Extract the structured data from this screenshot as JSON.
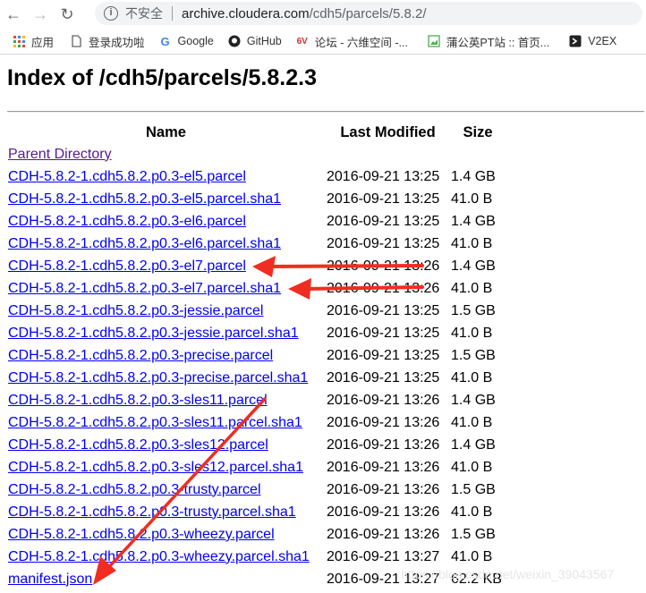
{
  "browser": {
    "security_label": "不安全",
    "url_host": "archive.cloudera.com",
    "url_path": "/cdh5/parcels/5.8.2/"
  },
  "bookmarks": [
    {
      "label": "应用",
      "icon": "apps-grid-icon"
    },
    {
      "label": "登录成功啦",
      "icon": "page-icon"
    },
    {
      "label": "Google",
      "icon": "google-icon"
    },
    {
      "label": "GitHub",
      "icon": "github-icon"
    },
    {
      "label": "论坛 - 六维空间 -...",
      "icon": "site-icon"
    },
    {
      "label": "蒲公英PT站 :: 首页...",
      "icon": "image-icon"
    },
    {
      "label": "V2EX",
      "icon": "v2ex-icon"
    }
  ],
  "page": {
    "title": "Index of /cdh5/parcels/5.8.2.3",
    "columns": {
      "name": "Name",
      "last_modified": "Last Modified",
      "size": "Size"
    },
    "parent_link": "Parent Directory",
    "files": [
      {
        "name": "CDH-5.8.2-1.cdh5.8.2.p0.3-el5.parcel",
        "modified": "2016-09-21 13:25",
        "size": "1.4 GB"
      },
      {
        "name": "CDH-5.8.2-1.cdh5.8.2.p0.3-el5.parcel.sha1",
        "modified": "2016-09-21 13:25",
        "size": "41.0 B"
      },
      {
        "name": "CDH-5.8.2-1.cdh5.8.2.p0.3-el6.parcel",
        "modified": "2016-09-21 13:25",
        "size": "1.4 GB"
      },
      {
        "name": "CDH-5.8.2-1.cdh5.8.2.p0.3-el6.parcel.sha1",
        "modified": "2016-09-21 13:25",
        "size": "41.0 B"
      },
      {
        "name": "CDH-5.8.2-1.cdh5.8.2.p0.3-el7.parcel",
        "modified": "2016-09-21 13:26",
        "size": "1.4 GB"
      },
      {
        "name": "CDH-5.8.2-1.cdh5.8.2.p0.3-el7.parcel.sha1",
        "modified": "2016-09-21 13:26",
        "size": "41.0 B"
      },
      {
        "name": "CDH-5.8.2-1.cdh5.8.2.p0.3-jessie.parcel",
        "modified": "2016-09-21 13:25",
        "size": "1.5 GB"
      },
      {
        "name": "CDH-5.8.2-1.cdh5.8.2.p0.3-jessie.parcel.sha1",
        "modified": "2016-09-21 13:25",
        "size": "41.0 B"
      },
      {
        "name": "CDH-5.8.2-1.cdh5.8.2.p0.3-precise.parcel",
        "modified": "2016-09-21 13:25",
        "size": "1.5 GB"
      },
      {
        "name": "CDH-5.8.2-1.cdh5.8.2.p0.3-precise.parcel.sha1",
        "modified": "2016-09-21 13:25",
        "size": "41.0 B"
      },
      {
        "name": "CDH-5.8.2-1.cdh5.8.2.p0.3-sles11.parcel",
        "modified": "2016-09-21 13:26",
        "size": "1.4 GB"
      },
      {
        "name": "CDH-5.8.2-1.cdh5.8.2.p0.3-sles11.parcel.sha1",
        "modified": "2016-09-21 13:26",
        "size": "41.0 B"
      },
      {
        "name": "CDH-5.8.2-1.cdh5.8.2.p0.3-sles12.parcel",
        "modified": "2016-09-21 13:26",
        "size": "1.4 GB"
      },
      {
        "name": "CDH-5.8.2-1.cdh5.8.2.p0.3-sles12.parcel.sha1",
        "modified": "2016-09-21 13:26",
        "size": "41.0 B"
      },
      {
        "name": "CDH-5.8.2-1.cdh5.8.2.p0.3-trusty.parcel",
        "modified": "2016-09-21 13:26",
        "size": "1.5 GB"
      },
      {
        "name": "CDH-5.8.2-1.cdh5.8.2.p0.3-trusty.parcel.sha1",
        "modified": "2016-09-21 13:26",
        "size": "41.0 B"
      },
      {
        "name": "CDH-5.8.2-1.cdh5.8.2.p0.3-wheezy.parcel",
        "modified": "2016-09-21 13:26",
        "size": "1.5 GB"
      },
      {
        "name": "CDH-5.8.2-1.cdh5.8.2.p0.3-wheezy.parcel.sha1",
        "modified": "2016-09-21 13:27",
        "size": "41.0 B"
      },
      {
        "name": "manifest.json",
        "modified": "2016-09-21 13:27",
        "size": "62.2 KB"
      }
    ]
  },
  "watermark": "https://blog.csdn.net/weixin_39043567",
  "colors": {
    "link": "#0000ee",
    "visited": "#551a8b",
    "annotation_arrow": "#f02d20"
  }
}
